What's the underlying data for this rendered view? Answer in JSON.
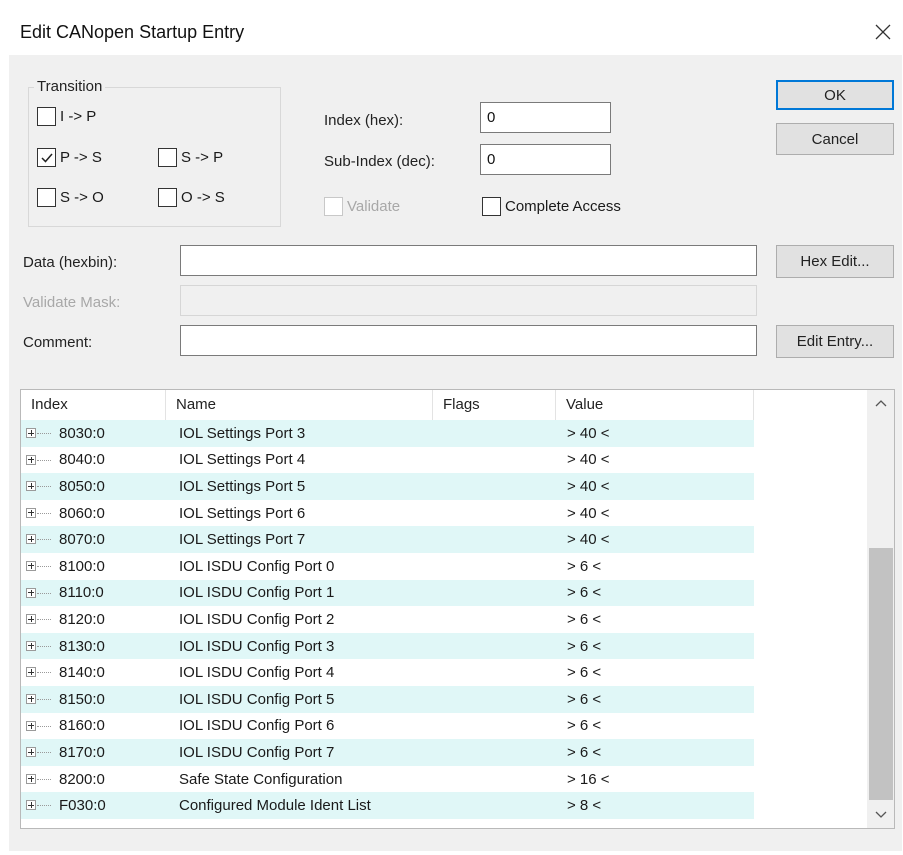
{
  "window": {
    "title": "Edit CANopen Startup Entry",
    "close_icon": "close-icon"
  },
  "transition": {
    "legend": "Transition",
    "items": [
      {
        "label": "I -> P",
        "checked": false
      },
      {
        "label": "P -> S",
        "checked": true
      },
      {
        "label": "S -> P",
        "checked": false
      },
      {
        "label": "S -> O",
        "checked": false
      },
      {
        "label": "O -> S",
        "checked": false
      }
    ]
  },
  "fields": {
    "index_label": "Index (hex):",
    "index_value": "0",
    "subindex_label": "Sub-Index (dec):",
    "subindex_value": "0",
    "validate_label": "Validate",
    "complete_access_label": "Complete Access",
    "data_label": "Data (hexbin):",
    "data_value": "",
    "validate_mask_label": "Validate Mask:",
    "validate_mask_value": "",
    "comment_label": "Comment:",
    "comment_value": ""
  },
  "buttons": {
    "ok": "OK",
    "cancel": "Cancel",
    "hex_edit": "Hex Edit...",
    "edit_entry": "Edit Entry..."
  },
  "table": {
    "columns": [
      "Index",
      "Name",
      "Flags",
      "Value"
    ],
    "rows": [
      {
        "index": "8030:0",
        "name": "IOL Settings Port 3",
        "flags": "",
        "value": "> 40 <"
      },
      {
        "index": "8040:0",
        "name": "IOL Settings Port 4",
        "flags": "",
        "value": "> 40 <"
      },
      {
        "index": "8050:0",
        "name": "IOL Settings Port 5",
        "flags": "",
        "value": "> 40 <"
      },
      {
        "index": "8060:0",
        "name": "IOL Settings Port 6",
        "flags": "",
        "value": "> 40 <"
      },
      {
        "index": "8070:0",
        "name": "IOL Settings Port 7",
        "flags": "",
        "value": "> 40 <"
      },
      {
        "index": "8100:0",
        "name": "IOL ISDU Config Port 0",
        "flags": "",
        "value": "> 6 <"
      },
      {
        "index": "8110:0",
        "name": "IOL ISDU Config Port 1",
        "flags": "",
        "value": "> 6 <"
      },
      {
        "index": "8120:0",
        "name": "IOL ISDU Config Port 2",
        "flags": "",
        "value": "> 6 <"
      },
      {
        "index": "8130:0",
        "name": "IOL ISDU Config Port 3",
        "flags": "",
        "value": "> 6 <"
      },
      {
        "index": "8140:0",
        "name": "IOL ISDU Config Port 4",
        "flags": "",
        "value": "> 6 <"
      },
      {
        "index": "8150:0",
        "name": "IOL ISDU Config Port 5",
        "flags": "",
        "value": "> 6 <"
      },
      {
        "index": "8160:0",
        "name": "IOL ISDU Config Port 6",
        "flags": "",
        "value": "> 6 <"
      },
      {
        "index": "8170:0",
        "name": "IOL ISDU Config Port 7",
        "flags": "",
        "value": "> 6 <"
      },
      {
        "index": "8200:0",
        "name": "Safe State Configuration",
        "flags": "",
        "value": "> 16 <"
      },
      {
        "index": "F030:0",
        "name": "Configured Module Ident List",
        "flags": "",
        "value": "> 8 <"
      }
    ]
  },
  "colors": {
    "alt_row": "#e0f7f7",
    "default_button_border": "#0078d7"
  }
}
